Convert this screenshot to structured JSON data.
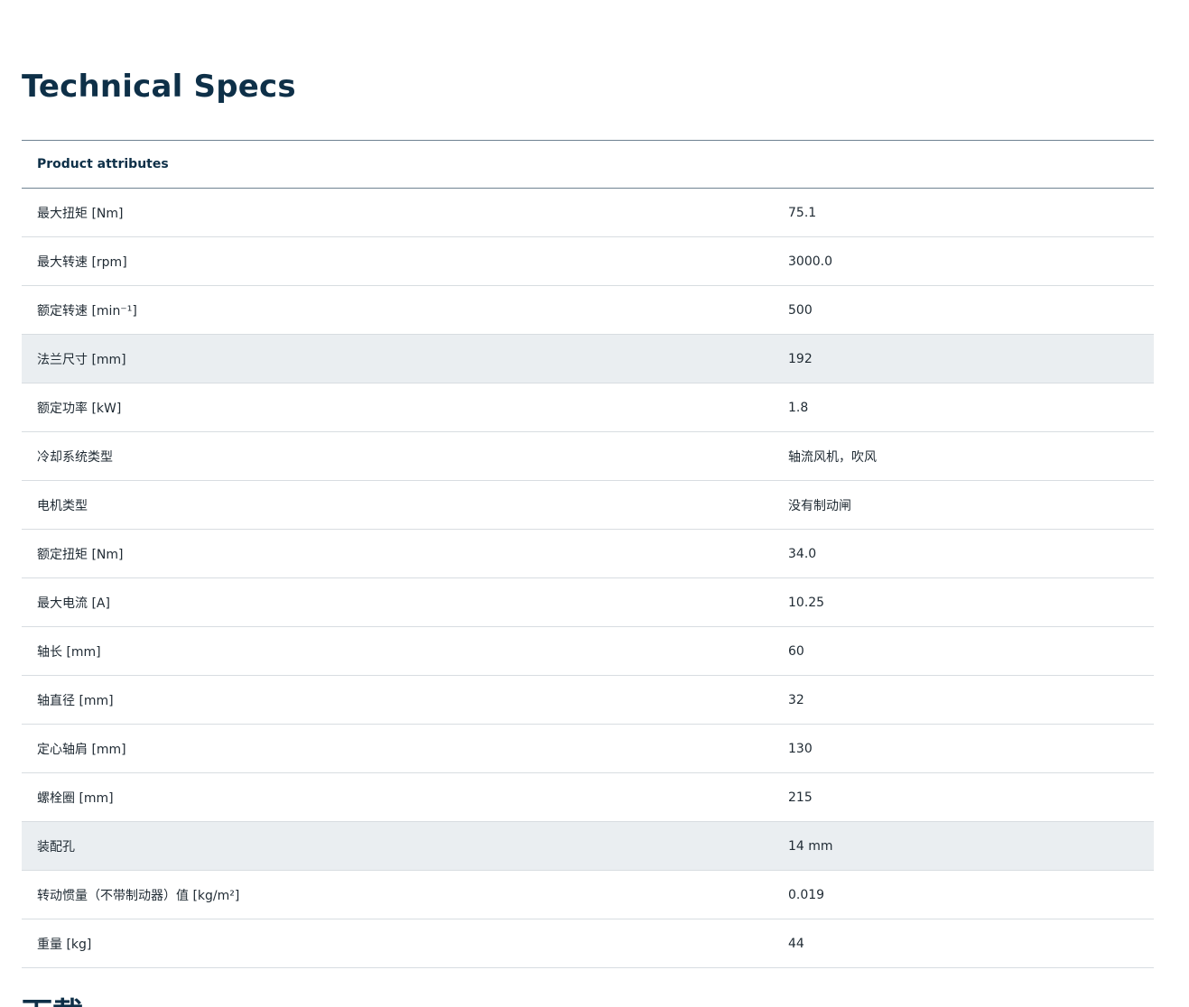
{
  "section": {
    "title": "Technical Specs"
  },
  "table": {
    "header": "Product attributes",
    "rows": [
      {
        "label": "最大扭矩 [Nm]",
        "value": "75.1"
      },
      {
        "label": "最大转速 [rpm]",
        "value": "3000.0"
      },
      {
        "label": "额定转速 [min⁻¹]",
        "value": "500"
      },
      {
        "label": "法兰尺寸 [mm]",
        "value": "192"
      },
      {
        "label": "额定功率 [kW]",
        "value": "1.8"
      },
      {
        "label": "冷却系统类型",
        "value": "轴流风机，吹风"
      },
      {
        "label": "电机类型",
        "value": "没有制动闸"
      },
      {
        "label": "额定扭矩 [Nm]",
        "value": "34.0"
      },
      {
        "label": "最大电流 [A]",
        "value": "10.25"
      },
      {
        "label": "轴长 [mm]",
        "value": "60"
      },
      {
        "label": "轴直径 [mm]",
        "value": "32"
      },
      {
        "label": "定心轴肩 [mm]",
        "value": "130"
      },
      {
        "label": "螺栓圈 [mm]",
        "value": "215"
      },
      {
        "label": "装配孔",
        "value": "14 mm"
      },
      {
        "label": "转动惯量（不带制动器）值 [kg/m²]",
        "value": "0.019"
      },
      {
        "label": "重量 [kg]",
        "value": "44"
      }
    ]
  },
  "next_section": {
    "title": "下载"
  },
  "colors": {
    "title": "#0e3048",
    "row_highlight": "#eaeef1",
    "divider": "#d8dde1",
    "header_rule": "#6f8291"
  }
}
